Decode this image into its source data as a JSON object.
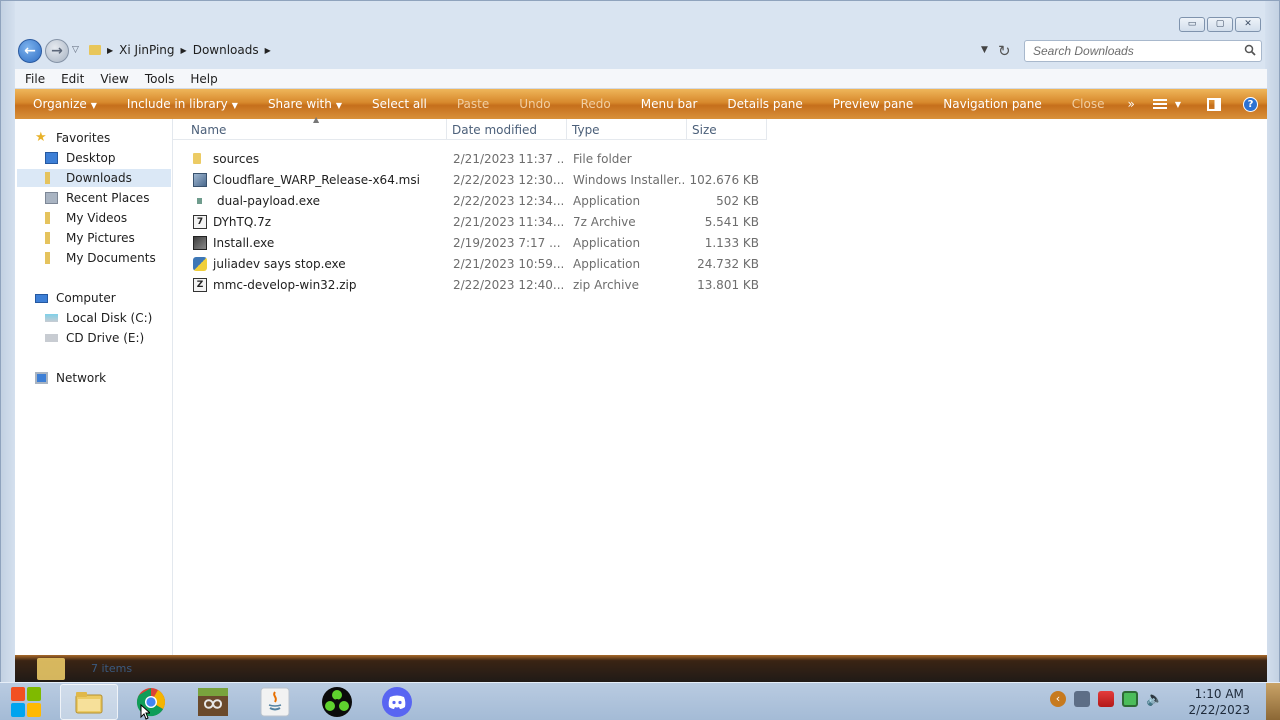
{
  "window": {
    "caption_buttons": {
      "minimize": "▭",
      "maximize": "▢",
      "close": "✕"
    }
  },
  "address": {
    "breadcrumbs": [
      "Xi JinPing",
      "Downloads"
    ],
    "search_placeholder": "Search Downloads"
  },
  "menubar": [
    "File",
    "Edit",
    "View",
    "Tools",
    "Help"
  ],
  "commandbar": {
    "items": [
      {
        "label": "Organize",
        "dropdown": true,
        "disabled": false
      },
      {
        "label": "Include in library",
        "dropdown": true,
        "disabled": false
      },
      {
        "label": "Share with",
        "dropdown": true,
        "disabled": false
      },
      {
        "label": "Select all",
        "dropdown": false,
        "disabled": false
      },
      {
        "label": "Paste",
        "dropdown": false,
        "disabled": true
      },
      {
        "label": "Undo",
        "dropdown": false,
        "disabled": true
      },
      {
        "label": "Redo",
        "dropdown": false,
        "disabled": true
      },
      {
        "label": "Menu bar",
        "dropdown": false,
        "disabled": false
      },
      {
        "label": "Details pane",
        "dropdown": false,
        "disabled": false
      },
      {
        "label": "Preview pane",
        "dropdown": false,
        "disabled": false
      },
      {
        "label": "Navigation pane",
        "dropdown": false,
        "disabled": false
      },
      {
        "label": "Close",
        "dropdown": false,
        "disabled": true
      }
    ],
    "more": "»",
    "help": "?"
  },
  "navpane": {
    "favorites": "Favorites",
    "favorite_items": [
      "Desktop",
      "Downloads",
      "Recent Places",
      "My Videos",
      "My Pictures",
      "My Documents"
    ],
    "computer": "Computer",
    "computer_items": [
      "Local Disk (C:)",
      "CD Drive (E:)"
    ],
    "network": "Network",
    "selected": "Downloads"
  },
  "columns": {
    "name": "Name",
    "date": "Date modified",
    "type": "Type",
    "size": "Size"
  },
  "files": [
    {
      "name": "sources",
      "date": "2/21/2023 11:37 ...",
      "type": "File folder",
      "size": "",
      "icon": "folder-icon"
    },
    {
      "name": "Cloudflare_WARP_Release-x64.msi",
      "date": "2/22/2023 12:30...",
      "type": "Windows Installer...",
      "size": "102.676 KB",
      "icon": "msi-icon"
    },
    {
      "name": "dual-payload.exe",
      "date": "2/22/2023 12:34...",
      "type": "Application",
      "size": "502 KB",
      "icon": "exe-icon"
    },
    {
      "name": "DYhTQ.7z",
      "date": "2/21/2023 11:34...",
      "type": "7z Archive",
      "size": "5.541 KB",
      "icon": "archive-icon"
    },
    {
      "name": "Install.exe",
      "date": "2/19/2023 7:17 ...",
      "type": "Application",
      "size": "1.133 KB",
      "icon": "installer-icon"
    },
    {
      "name": "juliadev says stop.exe",
      "date": "2/21/2023 10:59...",
      "type": "Application",
      "size": "24.732 KB",
      "icon": "python-exe-icon"
    },
    {
      "name": "mmc-develop-win32.zip",
      "date": "2/22/2023 12:40...",
      "type": "zip Archive",
      "size": "13.801 KB",
      "icon": "zip-icon"
    }
  ],
  "details": {
    "text": "7 items"
  },
  "taskbar": {
    "apps": [
      "file-explorer-icon",
      "chrome-icon",
      "minecraft-launcher-icon",
      "java-icon",
      "greenshot-icon",
      "discord-icon"
    ],
    "time": "1:10 AM",
    "date": "2/22/2023"
  },
  "colors": {
    "accent_orange": "#d7882c",
    "selection": "#dbe8f6",
    "taskbar": "#a4bbd6"
  }
}
